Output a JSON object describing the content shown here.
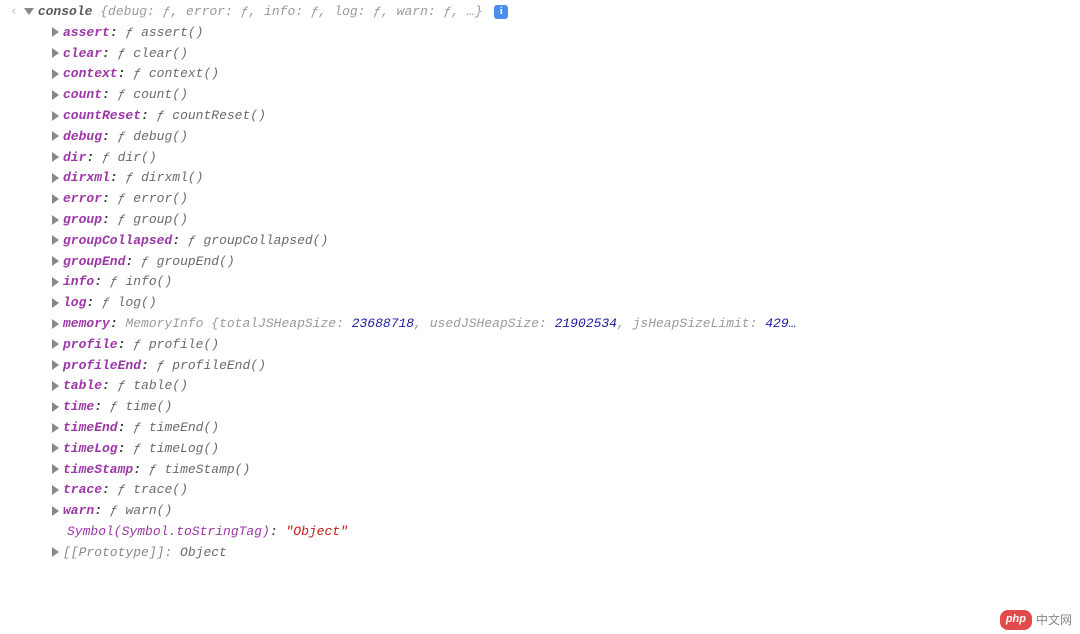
{
  "header": {
    "back_glyph": "‹",
    "obj_name": "console",
    "summary": "{debug: ƒ, error: ƒ, info: ƒ, log: ƒ, warn: ƒ, …}",
    "info_glyph": "i"
  },
  "props": [
    {
      "key": "assert",
      "fn": "assert()"
    },
    {
      "key": "clear",
      "fn": "clear()"
    },
    {
      "key": "context",
      "fn": "context()"
    },
    {
      "key": "count",
      "fn": "count()"
    },
    {
      "key": "countReset",
      "fn": "countReset()"
    },
    {
      "key": "debug",
      "fn": "debug()"
    },
    {
      "key": "dir",
      "fn": "dir()"
    },
    {
      "key": "dirxml",
      "fn": "dirxml()"
    },
    {
      "key": "error",
      "fn": "error()"
    },
    {
      "key": "group",
      "fn": "group()"
    },
    {
      "key": "groupCollapsed",
      "fn": "groupCollapsed()"
    },
    {
      "key": "groupEnd",
      "fn": "groupEnd()"
    },
    {
      "key": "info",
      "fn": "info()"
    },
    {
      "key": "log",
      "fn": "log()"
    }
  ],
  "memory": {
    "key": "memory",
    "typeName": "MemoryInfo",
    "totalLabel": "totalJSHeapSize",
    "totalValue": "23688718",
    "usedLabel": "usedJSHeapSize",
    "usedValue": "21902534",
    "limitLabel": "jsHeapSizeLimit",
    "limitValue": "429…"
  },
  "props2": [
    {
      "key": "profile",
      "fn": "profile()"
    },
    {
      "key": "profileEnd",
      "fn": "profileEnd()"
    },
    {
      "key": "table",
      "fn": "table()"
    },
    {
      "key": "time",
      "fn": "time()"
    },
    {
      "key": "timeEnd",
      "fn": "timeEnd()"
    },
    {
      "key": "timeLog",
      "fn": "timeLog()"
    },
    {
      "key": "timeStamp",
      "fn": "timeStamp()"
    },
    {
      "key": "trace",
      "fn": "trace()"
    },
    {
      "key": "warn",
      "fn": "warn()"
    }
  ],
  "symbol": {
    "key": "Symbol(Symbol.toStringTag)",
    "value": "\"Object\""
  },
  "proto": {
    "key": "[[Prototype]]",
    "value": "Object"
  },
  "f_glyph": "ƒ",
  "watermark": {
    "pill": "php",
    "text": "中文网"
  }
}
